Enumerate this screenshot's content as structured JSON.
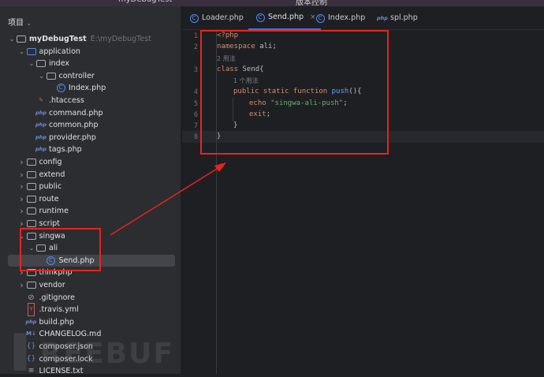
{
  "topbar": {
    "project": "myDebugTest",
    "vcs": "版本控制"
  },
  "sidebar": {
    "title": "项目",
    "tree": [
      {
        "label": "myDebugTest",
        "path": "E:\\myDebugTest",
        "level": 0,
        "chev": "open",
        "icon": "folder",
        "bold": true
      },
      {
        "label": "application",
        "level": 1,
        "chev": "open",
        "icon": "folder-blue"
      },
      {
        "label": "index",
        "level": 2,
        "chev": "open",
        "icon": "folder"
      },
      {
        "label": "controller",
        "level": 3,
        "chev": "open",
        "icon": "folder"
      },
      {
        "label": "Index.php",
        "level": 4,
        "icon": "class"
      },
      {
        "label": ".htaccess",
        "level": 2,
        "icon": "htaccess"
      },
      {
        "label": "command.php",
        "level": 2,
        "icon": "php"
      },
      {
        "label": "common.php",
        "level": 2,
        "icon": "php"
      },
      {
        "label": "provider.php",
        "level": 2,
        "icon": "php"
      },
      {
        "label": "tags.php",
        "level": 2,
        "icon": "php"
      },
      {
        "label": "config",
        "level": 1,
        "chev": "closed",
        "icon": "folder"
      },
      {
        "label": "extend",
        "level": 1,
        "chev": "closed",
        "icon": "folder"
      },
      {
        "label": "public",
        "level": 1,
        "chev": "closed",
        "icon": "folder"
      },
      {
        "label": "route",
        "level": 1,
        "chev": "closed",
        "icon": "folder"
      },
      {
        "label": "runtime",
        "level": 1,
        "chev": "closed",
        "icon": "folder"
      },
      {
        "label": "script",
        "level": 1,
        "chev": "closed",
        "icon": "folder"
      },
      {
        "label": "singwa",
        "level": 1,
        "chev": "open",
        "icon": "folder"
      },
      {
        "label": "ali",
        "level": 2,
        "chev": "open",
        "icon": "folder"
      },
      {
        "label": "Send.php",
        "level": 3,
        "icon": "class",
        "selected": true
      },
      {
        "label": "thinkphp",
        "level": 1,
        "chev": "closed",
        "icon": "folder"
      },
      {
        "label": "vendor",
        "level": 1,
        "chev": "closed",
        "icon": "folder"
      },
      {
        "label": ".gitignore",
        "level": 1,
        "icon": "ignore"
      },
      {
        "label": ".travis.yml",
        "level": 1,
        "icon": "yml"
      },
      {
        "label": "build.php",
        "level": 1,
        "icon": "php"
      },
      {
        "label": "CHANGELOG.md",
        "level": 1,
        "icon": "md"
      },
      {
        "label": "composer.json",
        "level": 1,
        "icon": "json"
      },
      {
        "label": "composer.lock",
        "level": 1,
        "icon": "json"
      },
      {
        "label": "LICENSE.txt",
        "level": 1,
        "icon": "txt"
      }
    ]
  },
  "tabs": [
    {
      "label": "Loader.php",
      "icon": "class"
    },
    {
      "label": "Send.php",
      "icon": "class",
      "active": true,
      "close": "×"
    },
    {
      "label": "Index.php",
      "icon": "class"
    },
    {
      "label": "spl.php",
      "icon": "php"
    }
  ],
  "editor": {
    "line_numbers": [
      "1",
      "2",
      "3",
      "4",
      "5",
      "6",
      "7",
      "8"
    ],
    "hints": [
      "2 用法",
      "1 个用法"
    ],
    "code": {
      "l1": "<?php",
      "l2a": "namespace",
      "l2b": " ali;",
      "l3a": "class",
      "l3b": " Send{",
      "l4a": "public static function",
      "l4b": " push",
      "l4c": "(){",
      "l5a": "echo",
      "l5b": " \"singwa-ali-push\"",
      "l5c": ";",
      "l6a": "exit",
      "l6b": ";",
      "l7": "}",
      "l8": "}"
    }
  },
  "watermark": "FREEBUF"
}
